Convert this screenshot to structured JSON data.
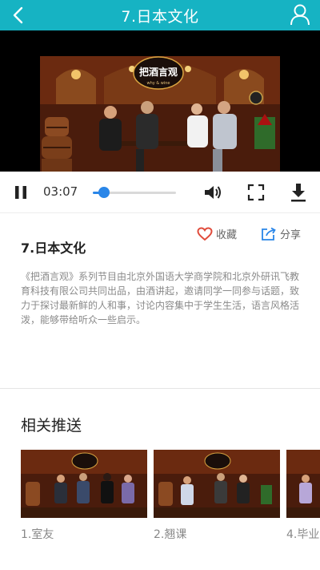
{
  "header": {
    "title": "7.日本文化"
  },
  "player": {
    "logo_text": "把酒言观",
    "logo_sub": "why & wine",
    "time": "03:07",
    "progress": 0.1
  },
  "episode": {
    "title": "7.日本文化",
    "favorite_label": "收藏",
    "share_label": "分享",
    "description": "《把酒言观》系列节目由北京外国语大学商学院和北京外研讯飞教育科技有限公司共同出品，由酒讲起，邀请同学一同参与话题，致力于探讨最新鲜的人和事，讨论内容集中于学生生活，语言风格活泼，能够带给听众一些启示。"
  },
  "related": {
    "title": "相关推送",
    "items": [
      {
        "label": "1.室友"
      },
      {
        "label": "2.翘课"
      },
      {
        "label": "4.毕业"
      }
    ]
  },
  "colors": {
    "header": "#16b3c3",
    "accent_blue": "#2a86e8",
    "favorite_red": "#e04b3b"
  }
}
